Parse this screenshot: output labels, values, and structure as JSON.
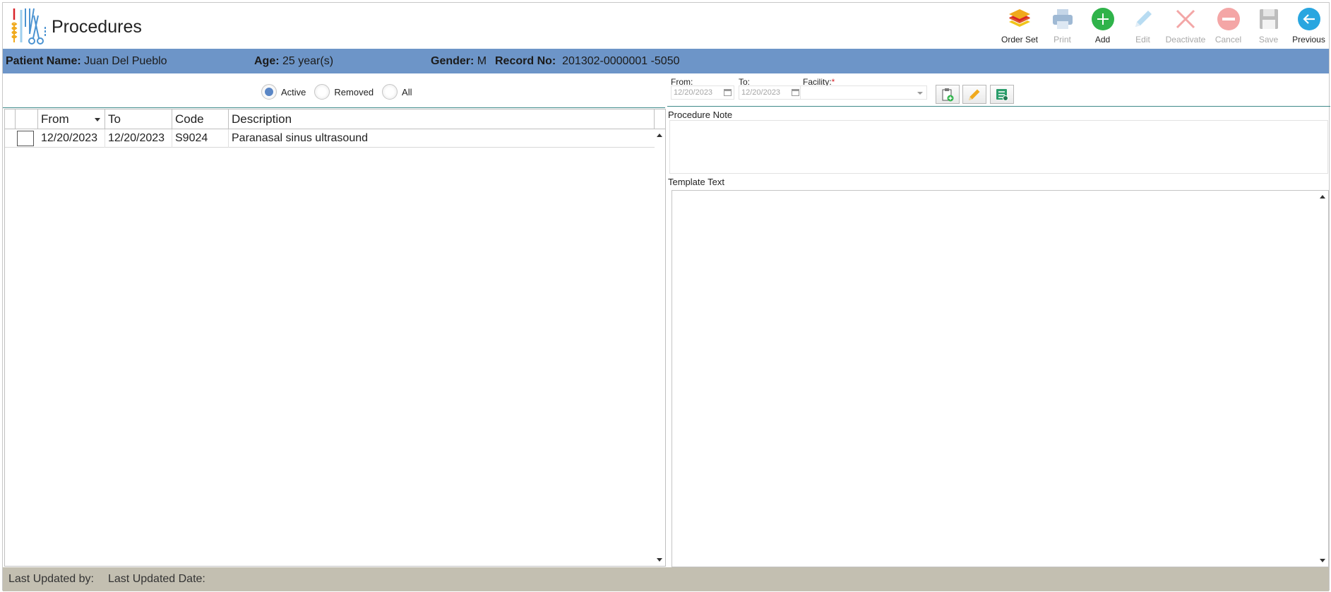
{
  "header": {
    "title": "Procedures"
  },
  "toolbar": {
    "order_set": "Order Set",
    "print": "Print",
    "add": "Add",
    "edit": "Edit",
    "deactivate": "Deactivate",
    "cancel": "Cancel",
    "save": "Save",
    "previous": "Previous"
  },
  "patient": {
    "name_label": "Patient Name:",
    "name": "Juan Del Pueblo",
    "age_label": "Age:",
    "age": "25 year(s)",
    "gender_label": "Gender:",
    "gender": "M",
    "record_label": "Record No:",
    "record": "201302-0000001 -5050"
  },
  "filter": {
    "options": [
      "Active",
      "Removed",
      "All"
    ],
    "selected": "Active"
  },
  "grid": {
    "columns": [
      "From",
      "To",
      "Code",
      "Description"
    ],
    "rows": [
      {
        "from": "12/20/2023",
        "to": "12/20/2023",
        "code": "S9024",
        "description": "Paranasal sinus ultrasound"
      }
    ]
  },
  "detail": {
    "from_label": "From:",
    "to_label": "To:",
    "facility_label": "Facility:",
    "required_mark": "*",
    "from_value": "12/20/2023",
    "to_value": "12/20/2023",
    "procedure_note_label": "Procedure Note",
    "template_text_label": "Template Text"
  },
  "footer": {
    "updated_by_label": "Last Updated by:",
    "updated_date_label": "Last Updated Date:"
  },
  "colors": {
    "patient_bar": "#6d95c8",
    "footer_bar": "#c3bfb1",
    "add_green": "#2fb34a",
    "previous_blue": "#29a6e0",
    "disabled_red": "#f3a6a6"
  }
}
